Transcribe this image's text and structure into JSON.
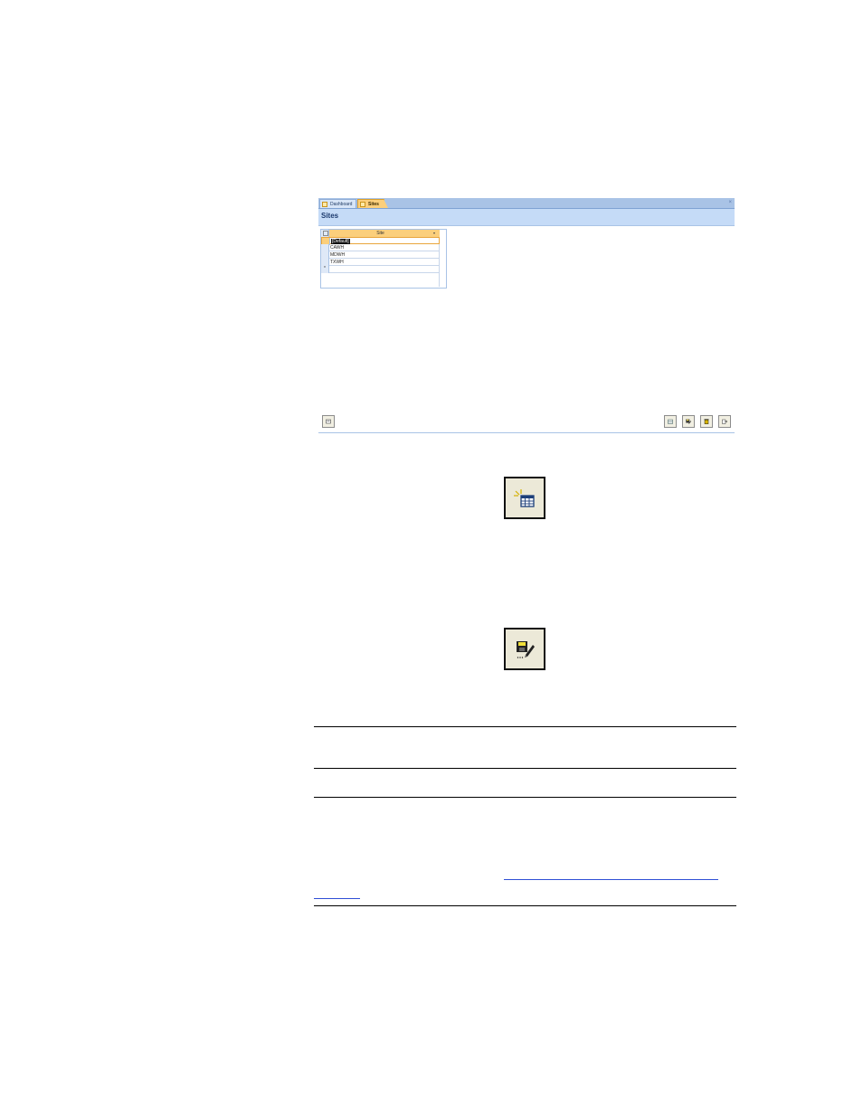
{
  "window": {
    "tabs": [
      {
        "label": "Dashboard"
      },
      {
        "label": "Sites"
      }
    ],
    "close_glyph": "×",
    "form_title": "Sites"
  },
  "grid": {
    "column_header": "Site",
    "sort_glyph": "▾",
    "rows": [
      {
        "value": "[Default]"
      },
      {
        "value": "CAWH"
      },
      {
        "value": "MDWH"
      },
      {
        "value": "TXWH"
      }
    ],
    "new_row_glyph": "*"
  },
  "toolbar": {
    "left_button_icon": "form-view-icon",
    "right_button_icons": [
      "new-record-icon",
      "save-edit-icon",
      "delete-icon",
      "close-form-icon"
    ]
  },
  "enlarged_icons": [
    "new-record-icon",
    "save-edit-icon"
  ],
  "colors": {
    "tab_active": "#fbcf7c",
    "tab_bar": "#a9c3e6",
    "title_band": "#c5dbf7",
    "link": "#2f4fd6"
  }
}
